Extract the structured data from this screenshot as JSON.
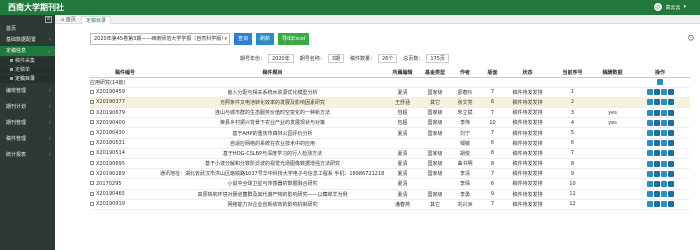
{
  "header": {
    "logo": "西南大学期刊社",
    "user": "高云云"
  },
  "sidebar": {
    "items": [
      {
        "label": "首页",
        "expandable": false
      },
      {
        "label": "基础数据配置",
        "expandable": true
      },
      {
        "label": "定稿信息",
        "expandable": true,
        "active": true
      },
      {
        "label": "编校管理",
        "expandable": true
      },
      {
        "label": "期刊计划",
        "expandable": true
      },
      {
        "label": "期刊管理",
        "expandable": true
      },
      {
        "label": "稿件管理",
        "expandable": true
      },
      {
        "label": "统计报表",
        "expandable": true
      }
    ],
    "sub_items": [
      {
        "label": "稿件采集"
      },
      {
        "label": "定稿单"
      },
      {
        "label": "定稿目录",
        "active": true
      }
    ]
  },
  "tabs": [
    {
      "label": "首页"
    },
    {
      "label": "定稿目录"
    }
  ],
  "filter": {
    "select": "2020年第45卷第3期——西南师范大学学报（自然科学版）",
    "btn_search": "查询",
    "btn_refresh": "刷新",
    "btn_export": "导出Excel"
  },
  "summary": {
    "issue_no_label": "期号年份：",
    "issue_no": "2020年",
    "issue_name_label": "期号名称：",
    "issue_name": "3期",
    "word_count_label": "稿件数量：",
    "word_count": "26个",
    "total_pages_label": "总页数：",
    "total_pages": "175页"
  },
  "table": {
    "headers": [
      "稿件编号",
      "稿件题目",
      "所属编辑",
      "基金类型",
      "作者",
      "版面",
      "状态",
      "当前序号",
      "稿酬数据",
      "操作"
    ],
    "section": "应用研究(14篇)",
    "rows": [
      {
        "id": "X20190459",
        "title": "嵌入分配与相关系统水资源优化模型分析",
        "editor": "夏清",
        "fund": "国家级",
        "author": "邵春玲",
        "pages": "7",
        "status": "稿件待发发排",
        "seq": "1",
        "fee": "",
        "hl": false
      },
      {
        "id": "X20190377",
        "title": "光照条件又电池转化效率的发展及影响因素研究",
        "editor": "王舒涵",
        "fund": "其它",
        "author": "张文亮",
        "pages": "6",
        "status": "稿件待发发排",
        "seq": "2",
        "fee": "",
        "hl": true
      },
      {
        "id": "X20190679",
        "title": "连山与城市群的生态服务价值时空变化的一种新方法",
        "editor": "包超",
        "fund": "国家级",
        "author": "朱立斌",
        "pages": "7",
        "status": "稿件待发发排",
        "seq": "3",
        "fee": "yes",
        "hl": false
      },
      {
        "id": "X20190400",
        "title": "荣县乡村振兴背景下农业产业的发展现状与对策",
        "editor": "包超",
        "fund": "国家级",
        "author": "李伟",
        "pages": "10",
        "status": "稿件待发发排",
        "seq": "4",
        "fee": "yes",
        "hl": false
      },
      {
        "id": "X20180430",
        "title": "基于AHP的重庆市森林公园评价分析",
        "editor": "夏清",
        "fund": "国家级",
        "author": "刘宁",
        "pages": "7",
        "status": "稿件待发发排",
        "seq": "5",
        "fee": "",
        "hl": false
      },
      {
        "id": "X20180531",
        "title": "自适应网络的系统在农业技术中的应用",
        "editor": "",
        "fund": "",
        "author": "邹敏",
        "pages": "6",
        "status": "稿件待发发排",
        "seq": "6",
        "fee": "",
        "hl": false
      },
      {
        "id": "X20190514",
        "title": "基于HOG-CSLBP与深度学习的行人检测方法",
        "editor": "夏清",
        "fund": "国家级",
        "author": "胡俊",
        "pages": "8",
        "status": "稿件待发发排",
        "seq": "7",
        "fee": "",
        "hl": false
      },
      {
        "id": "X20190695",
        "title": "基于小波分解和分数阶滤波的视觉光场图像数据增强方法研究",
        "editor": "夏清",
        "fund": "国家级",
        "author": "曲书明",
        "pages": "8",
        "status": "稿件待发发排",
        "seq": "8",
        "fee": "",
        "hl": false
      },
      {
        "id": "X20190289",
        "title": "通讯地址：湖北省武汉市洪山区珞喻路1037号华中科技大学电子与信息工程系  手机：18986721218  邮箱：587194@qq.com",
        "editor": "夏清",
        "fund": "国家级",
        "author": "李清",
        "pages": "7",
        "status": "稿件待发发排",
        "seq": "9",
        "fee": "",
        "hl": false
      },
      {
        "id": "20170295",
        "title": "小鼠中全球卫星与传感器的数据融合研究",
        "editor": "夏清",
        "fund": "",
        "author": "李倩",
        "pages": "6",
        "status": "稿件待发发排",
        "seq": "10",
        "fee": "",
        "hl": false
      },
      {
        "id": "X20190465",
        "title": "高原缺氧环境对肠道菌群及其代谢产物的影响研究——以藏绵羊为例",
        "editor": "夏清",
        "fund": "国家级",
        "author": "李勇",
        "pages": "9",
        "status": "稿件待发发排",
        "seq": "11",
        "fee": "",
        "hl": false
      },
      {
        "id": "X20190919",
        "title": "网络能力对企业创新绩效的影响机制研究",
        "editor": "潘春燕",
        "fund": "其它",
        "author": "刘兴洲",
        "pages": "7",
        "status": "稿件待发发排",
        "seq": "12",
        "fee": "",
        "hl": false
      }
    ]
  }
}
